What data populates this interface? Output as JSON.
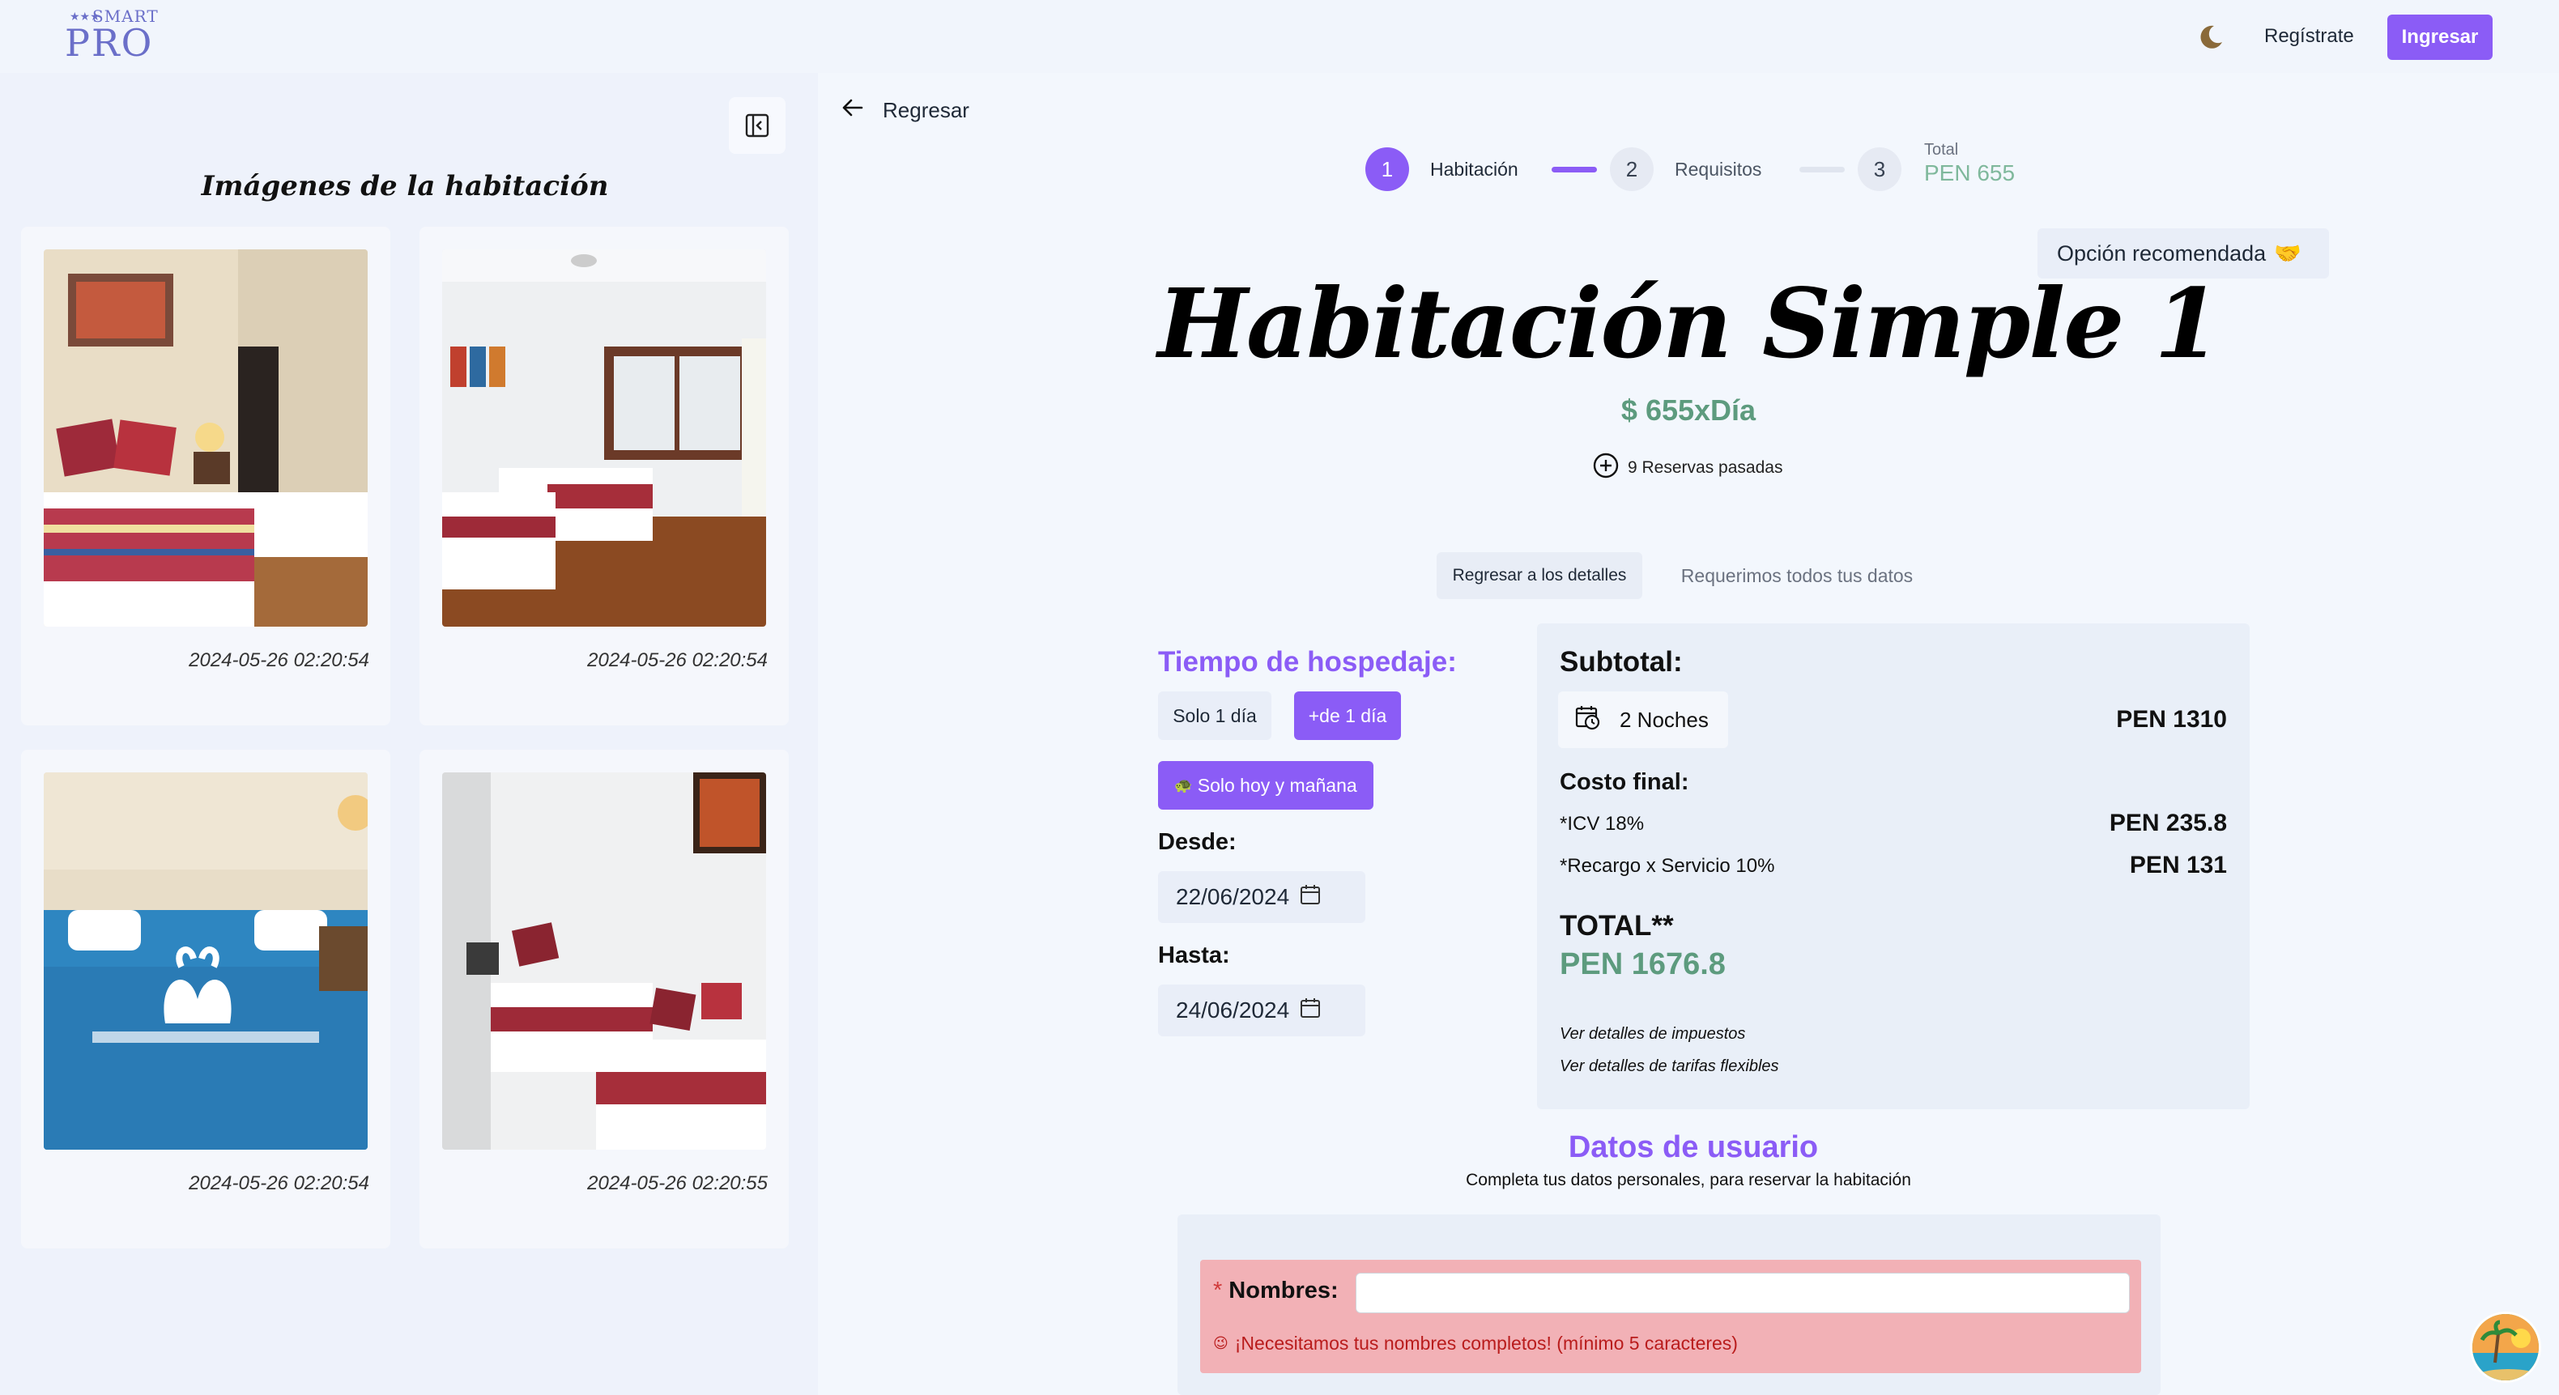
{
  "brand": {
    "small": "SMART",
    "big": "PRO"
  },
  "header": {
    "register_label": "Regístrate",
    "login_label": "Ingresar",
    "theme_icon": "moon-icon"
  },
  "gallery": {
    "title": "Imágenes de la habitación",
    "collapse_icon": "panel-collapse-icon",
    "images": [
      {
        "date": "2024-05-26 02:20:54"
      },
      {
        "date": "2024-05-26 02:20:54"
      },
      {
        "date": "2024-05-26 02:20:54"
      },
      {
        "date": "2024-05-26 02:20:55"
      }
    ]
  },
  "nav": {
    "back_label": "Regresar"
  },
  "steps": [
    {
      "number": "1",
      "label": "Habitación",
      "active": true
    },
    {
      "number": "2",
      "label": "Requisitos",
      "active": false
    },
    {
      "number": "3",
      "label": "Total",
      "value": "PEN 655",
      "active": false
    }
  ],
  "room": {
    "recommend_label": "Opción recomendada",
    "recommend_emoji": "🤝",
    "title": "Habitación Simple 1",
    "price": "$ 655xDía",
    "past_reservations": "9 Reservas pasadas"
  },
  "tabs": {
    "details": "Regresar a los detalles",
    "data": "Requerimos todos tus datos"
  },
  "stay": {
    "title": "Tiempo de hospedaje:",
    "option_one_day": "Solo 1 día",
    "option_more_days": "+de 1 día",
    "quick_option": "Solo hoy y mañana",
    "from_label": "Desde:",
    "from_value": "22/06/2024",
    "to_label": "Hasta:",
    "to_value": "24/06/2024"
  },
  "summary": {
    "subtotal_label": "Subtotal:",
    "nights": "2 Noches",
    "subtotal_amount": "PEN 1310",
    "final_label": "Costo final:",
    "igv_label": "*ICV 18%",
    "igv_amount": "PEN 235.8",
    "service_label": "*Recargo x Servicio 10%",
    "service_amount": "PEN 131",
    "total_label": "TOTAL**",
    "total_amount": "PEN 1676.8",
    "tax_details_link": "Ver detalles de impuestos",
    "flex_rates_link": "Ver detalles de tarifas flexibles"
  },
  "user_form": {
    "title": "Datos de usuario",
    "subtitle": "Completa tus datos personales, para reservar la habitación",
    "nombres_required": "*",
    "nombres_label": "Nombres:",
    "nombres_value": "",
    "nombres_error": "¡Necesitamos tus nombres completos! (mínimo 5 caracteres)"
  },
  "colors": {
    "accent": "#8b5cf6",
    "money": "#5d9b7e",
    "error_bg": "#f2b1b6"
  }
}
